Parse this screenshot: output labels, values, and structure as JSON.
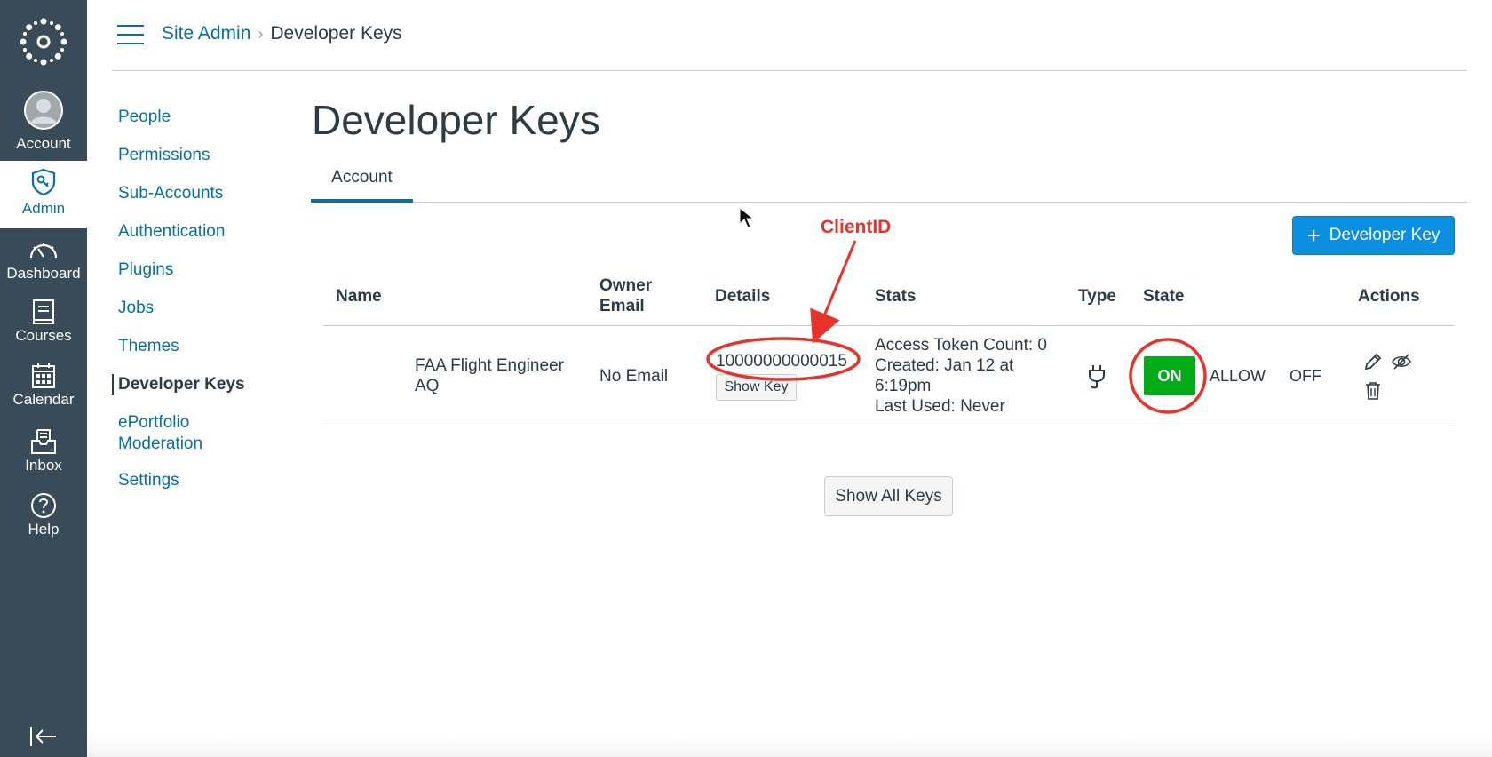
{
  "global_nav": {
    "account": "Account",
    "admin": "Admin",
    "dashboard": "Dashboard",
    "courses": "Courses",
    "calendar": "Calendar",
    "inbox": "Inbox",
    "help": "Help"
  },
  "breadcrumb": {
    "root": "Site Admin",
    "separator": "›",
    "current": "Developer Keys"
  },
  "sidebar": {
    "items": [
      {
        "label": "People"
      },
      {
        "label": "Permissions"
      },
      {
        "label": "Sub-Accounts"
      },
      {
        "label": "Authentication"
      },
      {
        "label": "Plugins"
      },
      {
        "label": "Jobs"
      },
      {
        "label": "Themes"
      },
      {
        "label": "Developer Keys"
      },
      {
        "label": "ePortfolio Moderation"
      },
      {
        "label": "Settings"
      }
    ]
  },
  "main": {
    "title": "Developer Keys",
    "tab": "Account",
    "add_button": "Developer Key",
    "show_all_button": "Show All Keys"
  },
  "table": {
    "headers": {
      "name": "Name",
      "owner_email_1": "Owner",
      "owner_email_2": "Email",
      "details": "Details",
      "stats": "Stats",
      "type": "Type",
      "state": "State",
      "actions": "Actions"
    },
    "row": {
      "name_1": "FAA Flight Engineer",
      "name_2": "AQ",
      "owner_email": "No Email",
      "client_id": "10000000000015",
      "show_key": "Show Key",
      "stats_1": "Access Token Count: 0",
      "stats_2": "Created: Jan 12 at",
      "stats_3": "6:19pm",
      "stats_4": "Last Used: Never",
      "state_on": "ON",
      "state_allow": "ALLOW",
      "state_off": "OFF"
    }
  },
  "annotation": {
    "label": "ClientID",
    "color": "#e8322b"
  },
  "colors": {
    "nav_bg": "#394b58",
    "link": "#0770a3",
    "primary_button": "#0b8fe0",
    "on_green": "#00ac18"
  }
}
